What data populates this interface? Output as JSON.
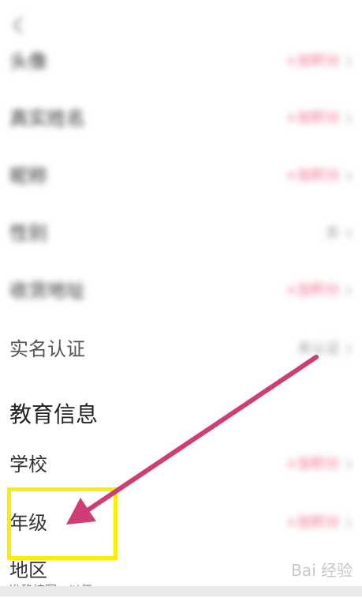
{
  "rows_blurred": [
    {
      "label": "头像",
      "value": "+加积分"
    },
    {
      "label": "真实姓名",
      "value": "+加积分"
    },
    {
      "label": "昵称",
      "value": "+加积分"
    },
    {
      "label": "性别",
      "value": "女"
    },
    {
      "label": "收货地址",
      "value": "+加积分"
    }
  ],
  "realname": {
    "label": "实名认证",
    "value": "未认证"
  },
  "education": {
    "title": "教育信息",
    "school": {
      "label": "学校",
      "value": "+加积分"
    },
    "grade": {
      "label": "年级",
      "value": "+加积分"
    },
    "region": {
      "label": "地区"
    },
    "hint": "准确填写，以便..."
  },
  "watermark": "Bai 经验",
  "colors": {
    "accent_pink": "#f06a8a",
    "arrow": "#cf3d77",
    "highlight": "#f6f000"
  }
}
